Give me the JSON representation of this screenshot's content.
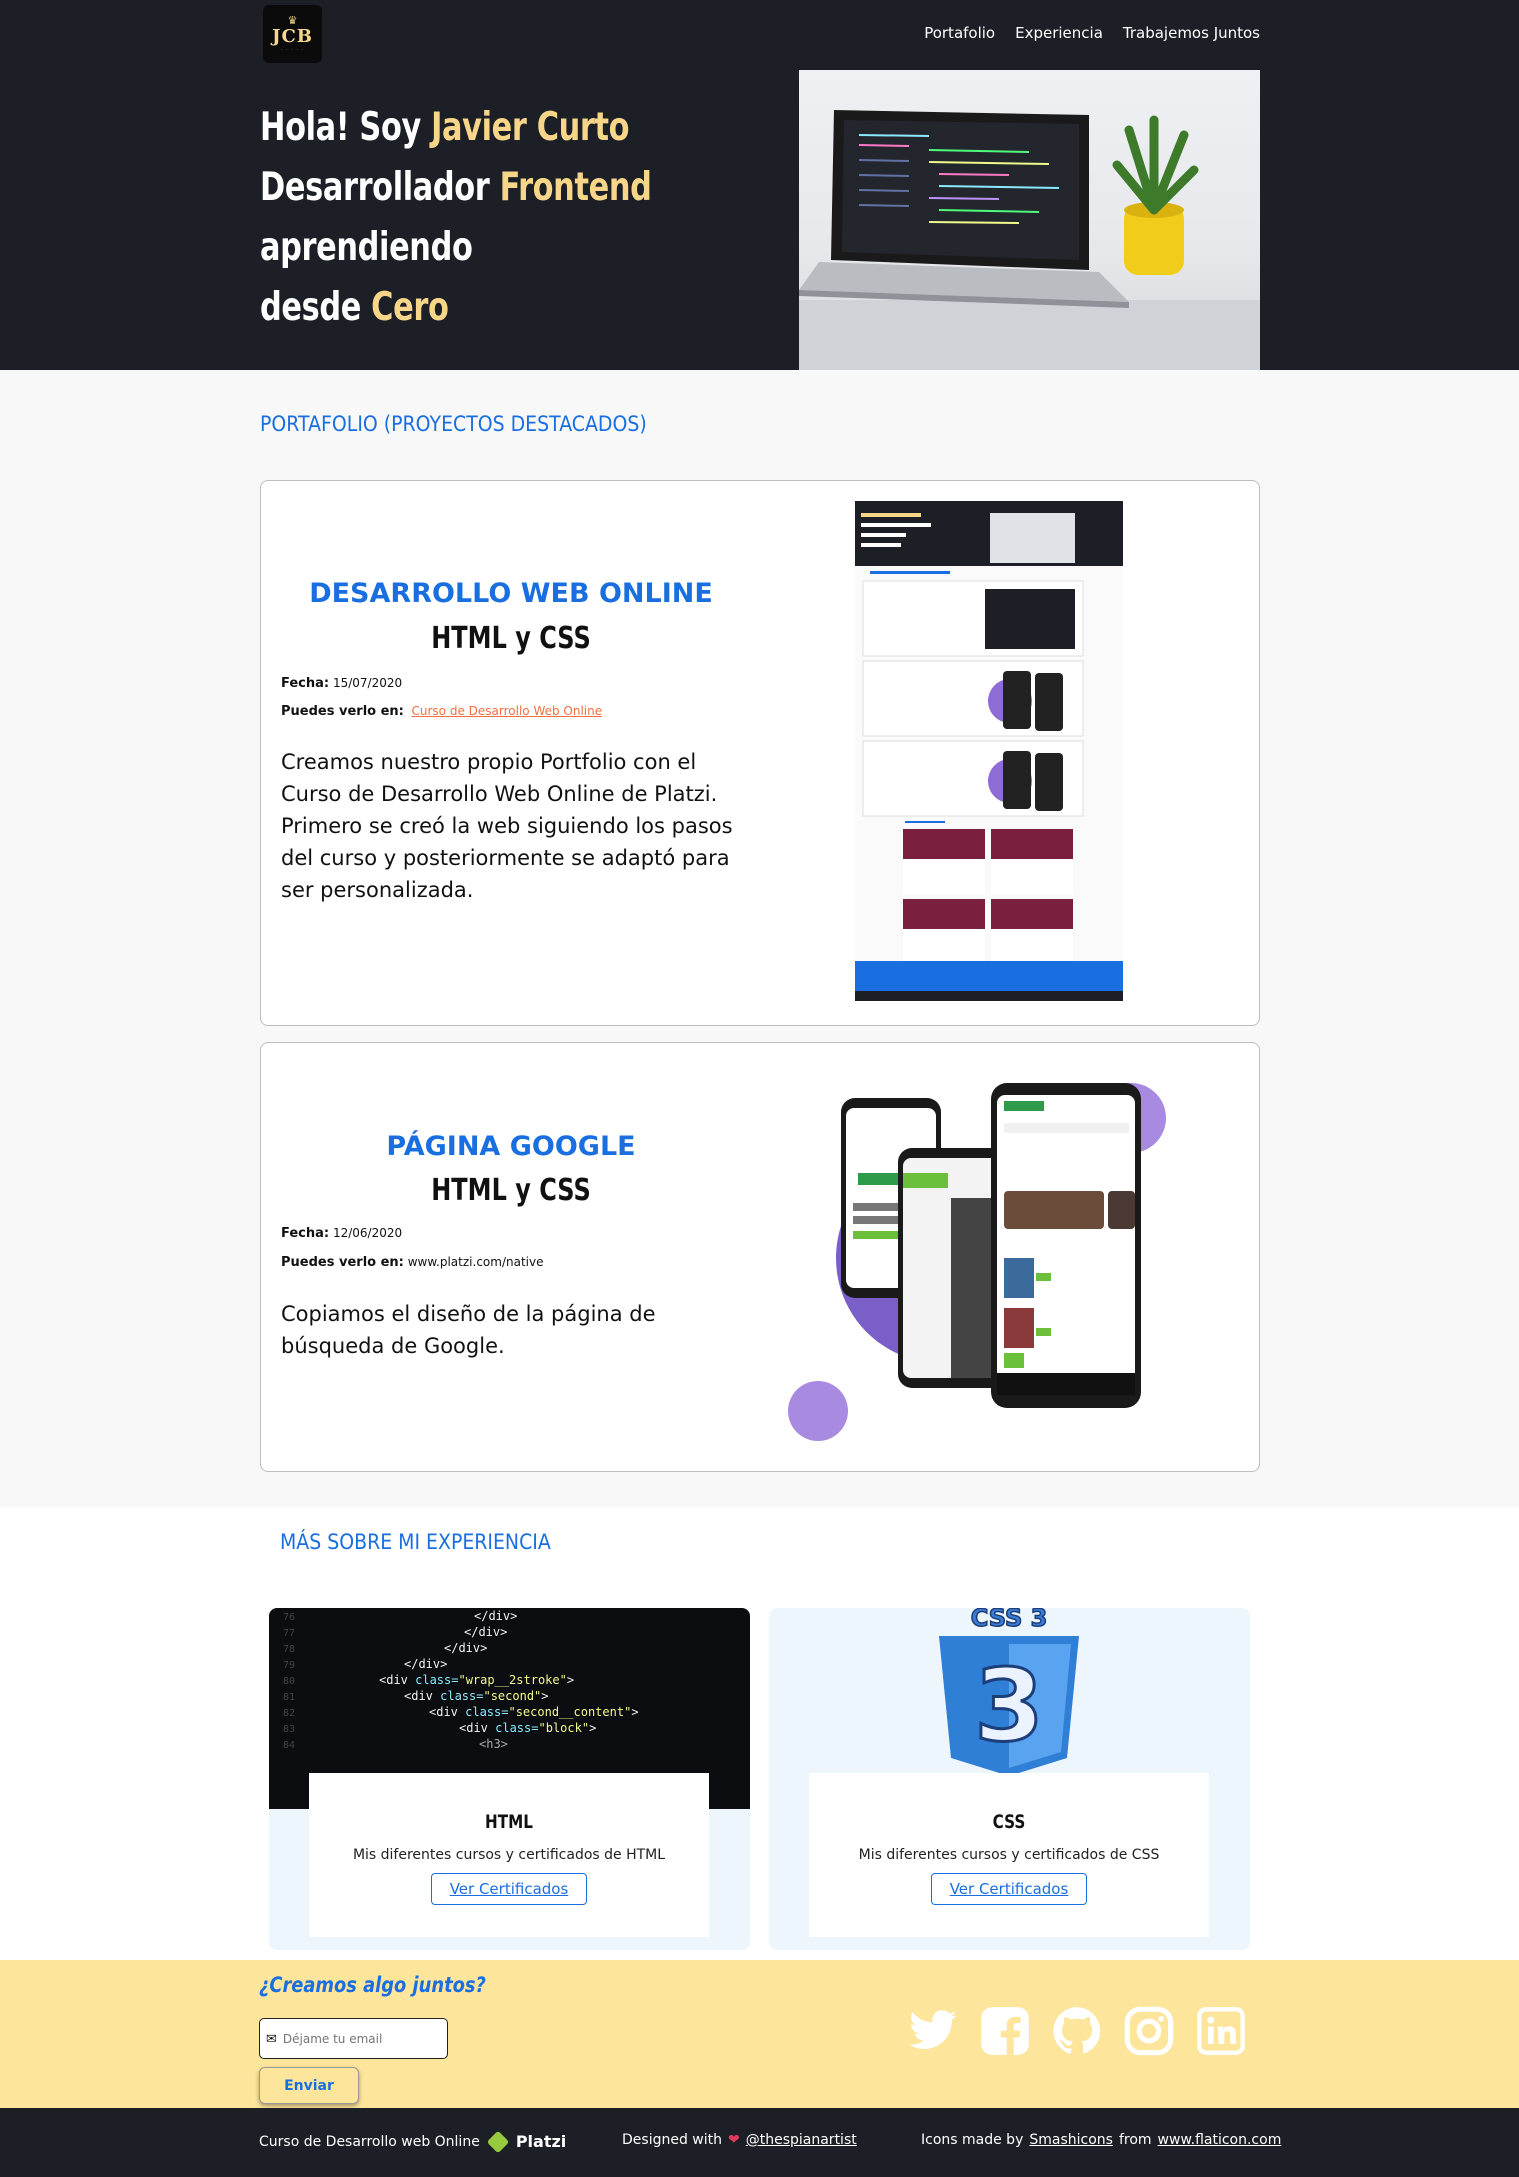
{
  "header": {
    "logo_text": "JCB",
    "nav": [
      "Portafolio",
      "Experiencia",
      "Trabajemos Juntos"
    ]
  },
  "hero": {
    "line1_a": "Hola! Soy ",
    "line1_b": "Javier Curto",
    "line2_a": "Desarrollador ",
    "line2_b": "Frontend",
    "line3": "aprendiendo",
    "line4_a": "desde ",
    "line4_b": "Cero"
  },
  "portfolio": {
    "title": "PORTAFOLIO (PROYECTOS DESTACADOS)",
    "projects": [
      {
        "title": "DESARROLLO WEB ONLINE",
        "subtitle": "HTML y CSS",
        "date_label": "Fecha:",
        "date": "15/07/2020",
        "see_label": "Puedes verlo en:",
        "see_value": "Curso de Desarrollo Web Online",
        "description": "Creamos nuestro propio Portfolio con el Curso de Desarrollo Web Online de Platzi. Primero se creó la web siguiendo los pasos del curso y posteriormente se adaptó para ser personalizada."
      },
      {
        "title": "PÁGINA GOOGLE",
        "subtitle": "HTML y CSS",
        "date_label": "Fecha:",
        "date": "12/06/2020",
        "see_label": "Puedes verlo en:",
        "see_value": "www.platzi.com/native",
        "description": "Copiamos el diseño de la página de búsqueda de Google."
      }
    ]
  },
  "experience": {
    "title": "MÁS SOBRE MI EXPERIENCIA",
    "cards": [
      {
        "title": "HTML",
        "description": "Mis diferentes cursos y certificados de HTML",
        "button": "Ver Certificados"
      },
      {
        "title": "CSS",
        "description": "Mis diferentes cursos y certificados de CSS",
        "button": "Ver Certificados"
      }
    ]
  },
  "contact": {
    "question": "¿Creamos algo juntos?",
    "email_placeholder": "Déjame tu email",
    "send": "Enviar",
    "socials": [
      "twitter-icon",
      "facebook-icon",
      "github-icon",
      "instagram-icon",
      "linkedin-icon"
    ]
  },
  "footer": {
    "course": "Curso de Desarrollo web Online",
    "platzi": "Platzi",
    "designed": "Designed with",
    "designer": "@thespianartist",
    "icons_a": "Icons made by",
    "icons_author": "Smashicons",
    "icons_from": "from",
    "icons_site": "www.flaticon.com"
  },
  "colors": {
    "accent_blue": "#1a6fe0",
    "highlight_yellow": "#f7d68a",
    "dark_bg": "#1c1f26",
    "contact_bg": "#fde59c"
  }
}
